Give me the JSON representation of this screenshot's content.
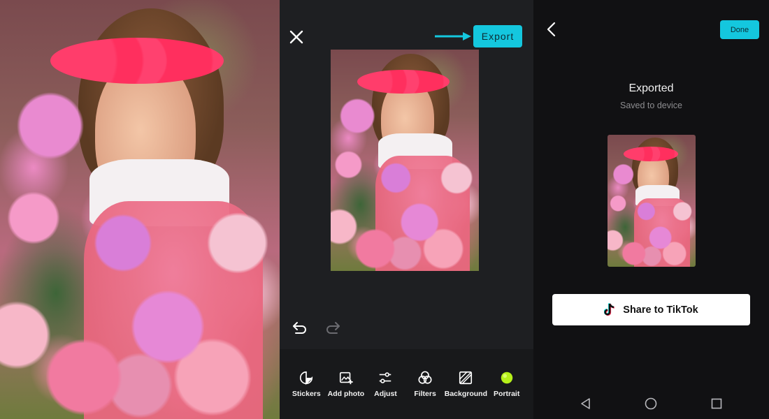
{
  "editor": {
    "export_label": "Export",
    "toolbar": [
      {
        "key": "stickers",
        "label": "Stickers",
        "icon": "sticker-icon"
      },
      {
        "key": "add_photo",
        "label": "Add photo",
        "icon": "add-photo-icon"
      },
      {
        "key": "adjust",
        "label": "Adjust",
        "icon": "sliders-icon"
      },
      {
        "key": "filters",
        "label": "Filters",
        "icon": "filters-icon"
      },
      {
        "key": "background",
        "label": "Background",
        "icon": "background-icon"
      },
      {
        "key": "portrait",
        "label": "Portrait",
        "icon": "portrait-icon"
      }
    ]
  },
  "exported": {
    "done_label": "Done",
    "title": "Exported",
    "subtitle": "Saved to device",
    "share_label": "Share to TikTok"
  },
  "colors": {
    "accent": "#14c7de",
    "portrait_dot": "#b6f01a",
    "editor_bg": "#1e1f22",
    "toolbar_bg": "#18191b",
    "exported_bg": "#111113"
  }
}
